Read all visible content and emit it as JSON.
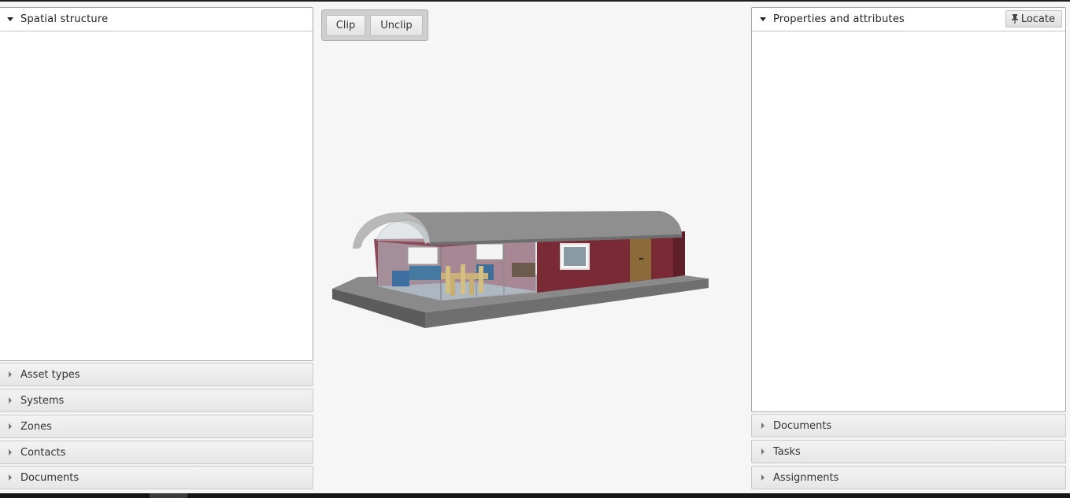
{
  "left_panel": {
    "title": "Spatial structure",
    "collapsed": [
      "Asset types",
      "Systems",
      "Zones",
      "Contacts",
      "Documents"
    ]
  },
  "toolbar": {
    "clip_label": "Clip",
    "unclip_label": "Unclip"
  },
  "right_panel": {
    "title": "Properties and attributes",
    "locate_label": "Locate",
    "collapsed": [
      "Documents",
      "Tasks",
      "Assignments"
    ]
  },
  "icons": {
    "expanded": "caret-down-icon",
    "collapsed": "caret-right-icon",
    "locate": "pin-icon"
  }
}
